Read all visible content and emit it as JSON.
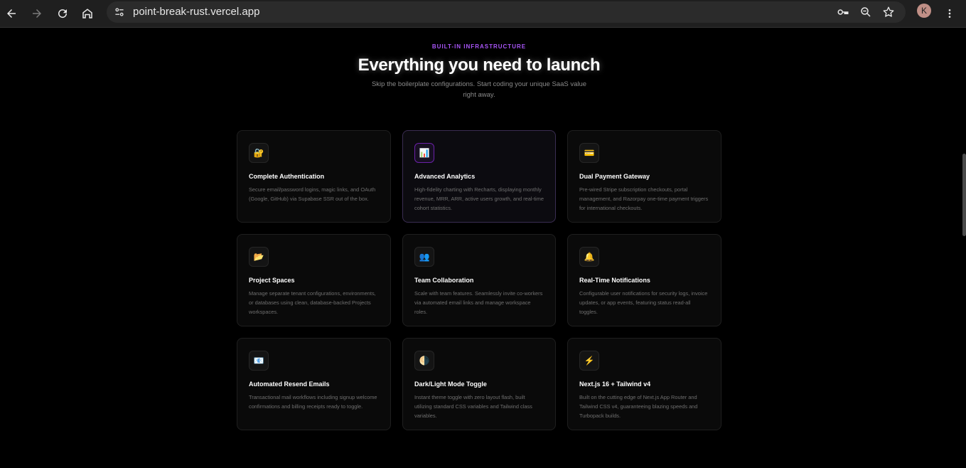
{
  "browser": {
    "url": "point-break-rust.vercel.app",
    "avatar_letter": "K"
  },
  "hero": {
    "eyebrow": "BUILT-IN INFRASTRUCTURE",
    "title": "Everything you need to launch",
    "subtitle": "Skip the boilerplate configurations. Start coding your unique SaaS value right away."
  },
  "features": [
    {
      "icon": "🔐",
      "icon_name": "lock-key-icon",
      "title": "Complete Authentication",
      "description": "Secure email/password logins, magic links, and OAuth (Google, GitHub) via Supabase SSR out of the box."
    },
    {
      "icon": "📊",
      "icon_name": "bar-chart-icon",
      "title": "Advanced Analytics",
      "description": "High-fidelity charting with Recharts, displaying monthly revenue, MRR, ARR, active users growth, and real-time cohort statistics."
    },
    {
      "icon": "💳",
      "icon_name": "credit-card-icon",
      "title": "Dual Payment Gateway",
      "description": "Pre-wired Stripe subscription checkouts, portal management, and Razorpay one-time payment triggers for international checkouts."
    },
    {
      "icon": "📂",
      "icon_name": "folder-icon",
      "title": "Project Spaces",
      "description": "Manage separate tenant configurations, environments, or databases using clean, database-backed Projects workspaces."
    },
    {
      "icon": "👥",
      "icon_name": "users-icon",
      "title": "Team Collaboration",
      "description": "Scale with team features. Seamlessly invite co-workers via automated email links and manage workspace roles."
    },
    {
      "icon": "🔔",
      "icon_name": "bell-icon",
      "title": "Real-Time Notifications",
      "description": "Configurable user notifications for security logs, invoice updates, or app events, featuring status read-all toggles."
    },
    {
      "icon": "📧",
      "icon_name": "envelope-icon",
      "title": "Automated Resend Emails",
      "description": "Transactional mail workflows including signup welcome confirmations and billing receipts ready to toggle."
    },
    {
      "icon": "🌗",
      "icon_name": "half-moon-icon",
      "title": "Dark/Light Mode Toggle",
      "description": "Instant theme toggle with zero layout flash, built utilizing standard CSS variables and Tailwind class variables."
    },
    {
      "icon": "⚡",
      "icon_name": "lightning-icon",
      "title": "Next.js 16 + Tailwind v4",
      "description": "Built on the cutting edge of Next.js App Router and Tailwind CSS v4, guaranteeing blazing speeds and Turbopack builds."
    }
  ],
  "colors": {
    "accent": "#a855f7",
    "background": "#000000",
    "card_background": "#0a0a0a"
  }
}
